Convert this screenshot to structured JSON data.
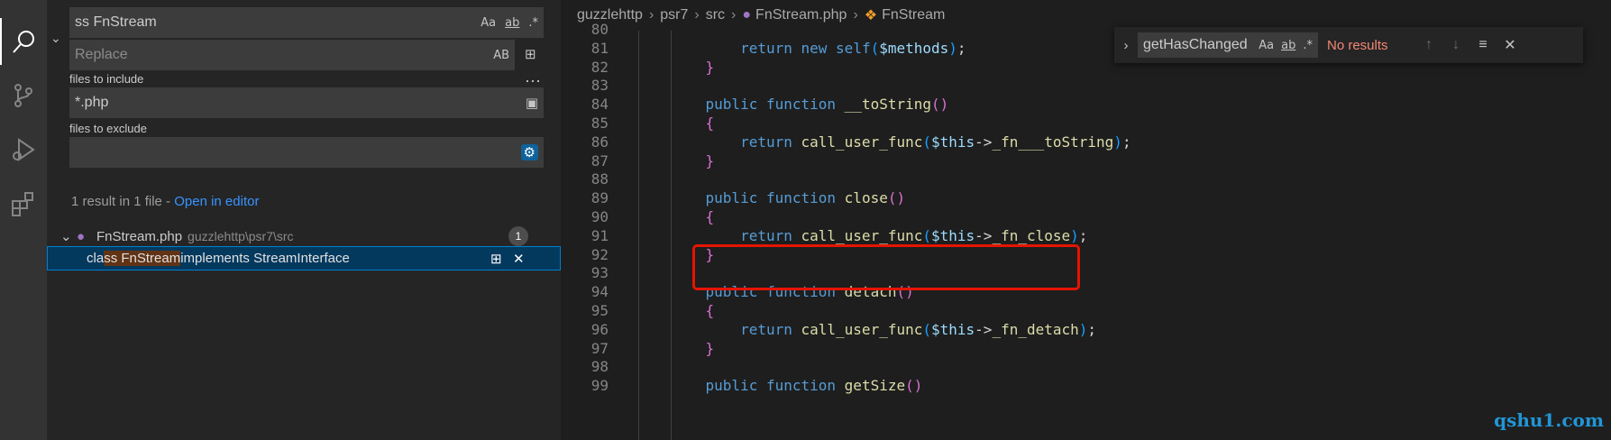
{
  "search": {
    "query": "ss FnStream",
    "replace_placeholder": "Replace",
    "opt_case": "Aa",
    "opt_word": "ab",
    "opt_regex": ".*",
    "opt_preserve_case": "AB",
    "include_label": "files to include",
    "include_value": "*.php",
    "exclude_label": "files to exclude",
    "exclude_value": "",
    "summary": "1 result in 1 file - ",
    "open_in_editor": "Open in editor",
    "file": {
      "name": "FnStream.php",
      "path": "guzzlehttp\\psr7\\src",
      "count": "1"
    },
    "match": {
      "before": "cla",
      "highlight": "ss FnStream",
      "after": " implements StreamInterface"
    }
  },
  "breadcrumb": [
    "guzzlehttp",
    "psr7",
    "src",
    "FnStream.php",
    "FnStream"
  ],
  "find_widget": {
    "query": "getHasChanged",
    "opt_case": "Aa",
    "opt_word": "ab",
    "opt_regex": ".*",
    "status": "No results"
  },
  "code_lines": [
    {
      "n": "80",
      "html": ""
    },
    {
      "n": "81",
      "html": "        <span class=\"kw\">return</span> <span class=\"kw\">new</span> <span class=\"kw\">self</span><span class=\"br2\">(</span><span class=\"var\">$methods</span><span class=\"br2\">)</span>;"
    },
    {
      "n": "82",
      "html": "    <span class=\"br1\">}</span>"
    },
    {
      "n": "83",
      "html": ""
    },
    {
      "n": "84",
      "html": "    <span class=\"kw\">public</span> <span class=\"kw\">function</span> <span class=\"fn\">__toString</span><span class=\"br1\">()</span>"
    },
    {
      "n": "85",
      "html": "    <span class=\"br1\">{</span>"
    },
    {
      "n": "86",
      "html": "        <span class=\"kw\">return</span> <span class=\"fn\">call_user_func</span><span class=\"br2\">(</span><span class=\"var\">$this</span>-&gt;<span class=\"fn\">_fn___toString</span><span class=\"br2\">)</span>;"
    },
    {
      "n": "87",
      "html": "    <span class=\"br1\">}</span>"
    },
    {
      "n": "88",
      "html": ""
    },
    {
      "n": "89",
      "html": "    <span class=\"kw\">public</span> <span class=\"kw\">function</span> <span class=\"fn\">close</span><span class=\"br1\">()</span>"
    },
    {
      "n": "90",
      "html": "    <span class=\"br1\">{</span>"
    },
    {
      "n": "91",
      "html": "        <span class=\"kw\">return</span> <span class=\"fn\">call_user_func</span><span class=\"br2\">(</span><span class=\"var\">$this</span>-&gt;<span class=\"fn\">_fn_close</span><span class=\"br2\">)</span>;"
    },
    {
      "n": "92",
      "html": "    <span class=\"br1\">}</span>"
    },
    {
      "n": "93",
      "html": ""
    },
    {
      "n": "94",
      "html": "    <span class=\"kw\">public</span> <span class=\"kw\">function</span> <span class=\"fn\">detach</span><span class=\"br1\">()</span>"
    },
    {
      "n": "95",
      "html": "    <span class=\"br1\">{</span>"
    },
    {
      "n": "96",
      "html": "        <span class=\"kw\">return</span> <span class=\"fn\">call_user_func</span><span class=\"br2\">(</span><span class=\"var\">$this</span>-&gt;<span class=\"fn\">_fn_detach</span><span class=\"br2\">)</span>;"
    },
    {
      "n": "97",
      "html": "    <span class=\"br1\">}</span>"
    },
    {
      "n": "98",
      "html": ""
    },
    {
      "n": "99",
      "html": "    <span class=\"kw\">public</span> <span class=\"kw\">function</span> <span class=\"fn\">getSize</span><span class=\"br1\">()</span>"
    }
  ],
  "watermark": "qshu1.com",
  "colors": {
    "accent_blue": "#3794ff",
    "no_results": "#f48771",
    "annotation_box": "#e51400",
    "selection": "#04395e"
  }
}
